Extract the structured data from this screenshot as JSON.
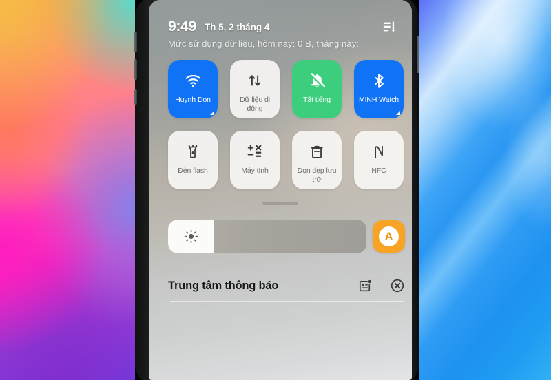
{
  "status": {
    "time": "9:49",
    "date": "Th 5, 2 tháng 4",
    "edit_icon": "sort-edit-icon",
    "data_usage": "Mức sử dụng dữ liệu, hôm nay: 0 B, tháng này:"
  },
  "tiles": [
    {
      "label": "Huynh Don",
      "icon": "wifi-icon",
      "state": "on-blue",
      "expandable": true,
      "name": "tile-wifi"
    },
    {
      "label": "Dữ liệu di động",
      "icon": "mobile-data-icon",
      "state": "off",
      "expandable": false,
      "name": "tile-mobile-data"
    },
    {
      "label": "Tắt tiếng",
      "icon": "bell-mute-icon",
      "state": "on-green",
      "expandable": false,
      "name": "tile-mute"
    },
    {
      "label": "MINH Watch",
      "icon": "bluetooth-icon",
      "state": "on-blue",
      "expandable": true,
      "name": "tile-bluetooth"
    },
    {
      "label": "Đèn flash",
      "icon": "flashlight-icon",
      "state": "off",
      "expandable": false,
      "name": "tile-flashlight"
    },
    {
      "label": "Máy tính",
      "icon": "calculator-icon",
      "state": "off",
      "expandable": false,
      "name": "tile-calculator"
    },
    {
      "label": "Dọn dẹp lưu trữ",
      "icon": "trash-clean-icon",
      "state": "off",
      "expandable": false,
      "name": "tile-storage-cleanup"
    },
    {
      "label": "NFC",
      "icon": "nfc-icon",
      "state": "off",
      "expandable": false,
      "name": "tile-nfc"
    }
  ],
  "brightness": {
    "slider_icon": "brightness-sun-icon",
    "fill_percent": 23,
    "auto_label": "A",
    "auto_name": "auto-brightness-button"
  },
  "notifications": {
    "title": "Trung tâm thông báo",
    "settings_icon": "notification-settings-icon",
    "clear_icon": "clear-all-icon"
  },
  "colors": {
    "tile_on_blue": "#1072f5",
    "tile_on_green": "#3dce7d",
    "tile_off": "#f6f5f3",
    "auto_brightness": "#f7a324",
    "label_off": "#6c6c6c"
  }
}
